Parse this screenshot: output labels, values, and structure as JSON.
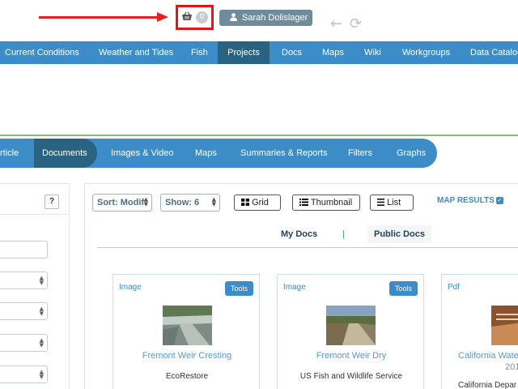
{
  "top_bar": {
    "cart_count": "0",
    "user_name": "Sarah Dolislager",
    "back_glyph": "←",
    "refresh_glyph": "⟳"
  },
  "main_nav": {
    "items": [
      "Current Conditions",
      "Weather and Tides",
      "Fish",
      "Projects",
      "Docs",
      "Maps",
      "Wiki",
      "Workgroups",
      "Data Catalog"
    ],
    "active": "Projects"
  },
  "sub_nav": {
    "items": [
      "rticle",
      "Documents",
      "Images & Video",
      "Maps",
      "Summaries & Reports",
      "Filters",
      "Graphs"
    ],
    "active": "Documents"
  },
  "left_panel": {
    "help_label": "?"
  },
  "toolbar": {
    "sort_label": "Sort: Modif",
    "show_label": "Show: 6",
    "grid_label": "Grid",
    "thumbnail_label": "Thumbnail",
    "list_label": "List",
    "map_results_label": "MAP RESULTS"
  },
  "doc_tabs": {
    "my_docs": "My Docs",
    "separator": "|",
    "public_docs": "Public Docs"
  },
  "cards": [
    {
      "type": "Image",
      "tools": "Tools",
      "title": "Fremont Weir Cresting",
      "org": "EcoRestore"
    },
    {
      "type": "Image",
      "tools": "Tools",
      "title": "Fremont Weir Dry",
      "org": "US Fish and Wildlife Service"
    },
    {
      "type": "Pdf",
      "tools": "",
      "title": "California Wate",
      "title_line2": "201",
      "org": "California Depar"
    }
  ],
  "colors": {
    "nav_blue": "#3c8dc7",
    "nav_active": "#2a6382",
    "annotation_red": "#e3141a",
    "user_button": "#6f8c9a",
    "link_blue": "#5b9ad2"
  }
}
